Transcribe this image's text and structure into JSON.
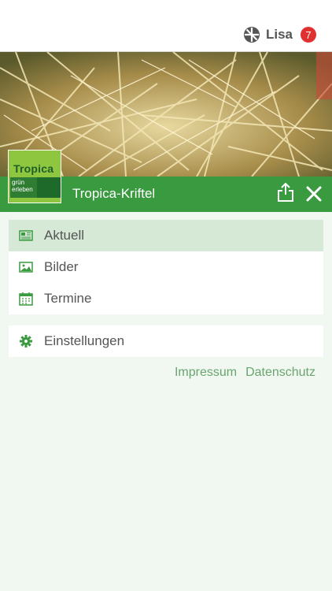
{
  "user": {
    "name": "Lisa",
    "badge_count": "7"
  },
  "brand": {
    "logo_title": "Tropica",
    "logo_sub": "grün erleben",
    "app_title": "Tropica-Kriftel",
    "accent_color": "#3a9a40"
  },
  "menu": {
    "primary": [
      {
        "label": "Aktuell",
        "icon": "news-icon",
        "active": true
      },
      {
        "label": "Bilder",
        "icon": "image-icon",
        "active": false
      },
      {
        "label": "Termine",
        "icon": "calendar-icon",
        "active": false
      }
    ],
    "secondary": [
      {
        "label": "Einstellungen",
        "icon": "gear-icon",
        "active": false
      }
    ]
  },
  "footer": {
    "impressum": "Impressum",
    "datenschutz": "Datenschutz"
  }
}
